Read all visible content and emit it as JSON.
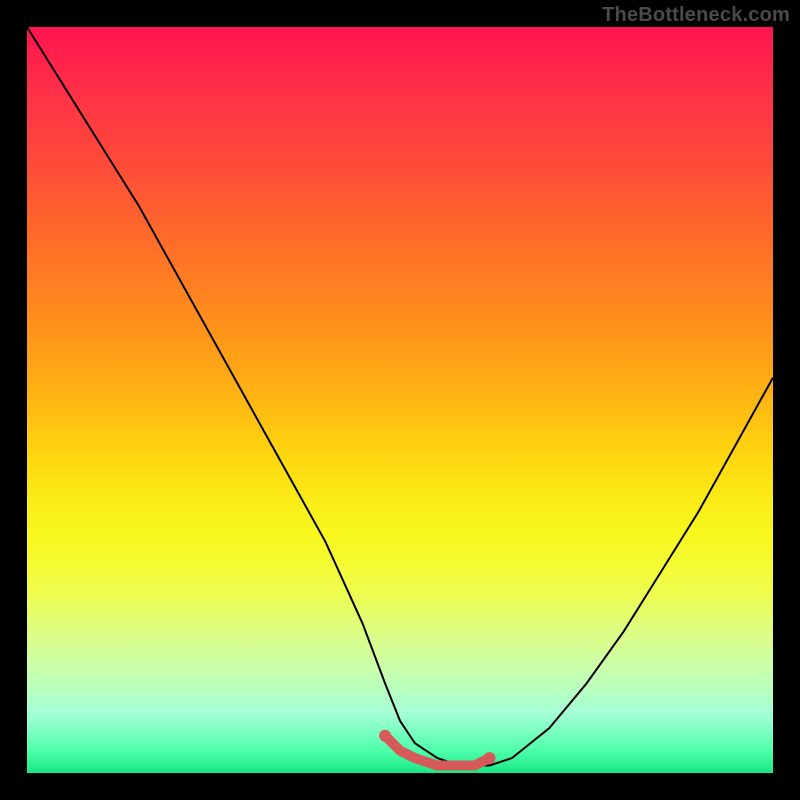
{
  "watermark": "TheBottleneck.com",
  "chart_data": {
    "type": "line",
    "title": "",
    "xlabel": "",
    "ylabel": "",
    "xlim": [
      0,
      100
    ],
    "ylim": [
      0,
      100
    ],
    "series": [
      {
        "name": "curve",
        "x": [
          0,
          5,
          10,
          15,
          20,
          25,
          30,
          35,
          40,
          45,
          48,
          50,
          52,
          55,
          58,
          60,
          62,
          65,
          70,
          75,
          80,
          85,
          90,
          95,
          100
        ],
        "values": [
          100,
          92,
          84,
          76,
          67,
          58,
          49,
          40,
          31,
          20,
          12,
          7,
          4,
          2,
          1,
          1,
          1,
          2,
          6,
          12,
          19,
          27,
          35,
          44,
          53
        ]
      },
      {
        "name": "highlight-segment",
        "x": [
          48,
          50,
          52,
          55,
          58,
          60,
          62
        ],
        "values": [
          5,
          3,
          2,
          1,
          1,
          1,
          2
        ]
      }
    ],
    "colors": {
      "curve": "#000000",
      "highlight": "#d65a5a",
      "gradient_top": "#ff1450",
      "gradient_bottom": "#17e884"
    }
  }
}
